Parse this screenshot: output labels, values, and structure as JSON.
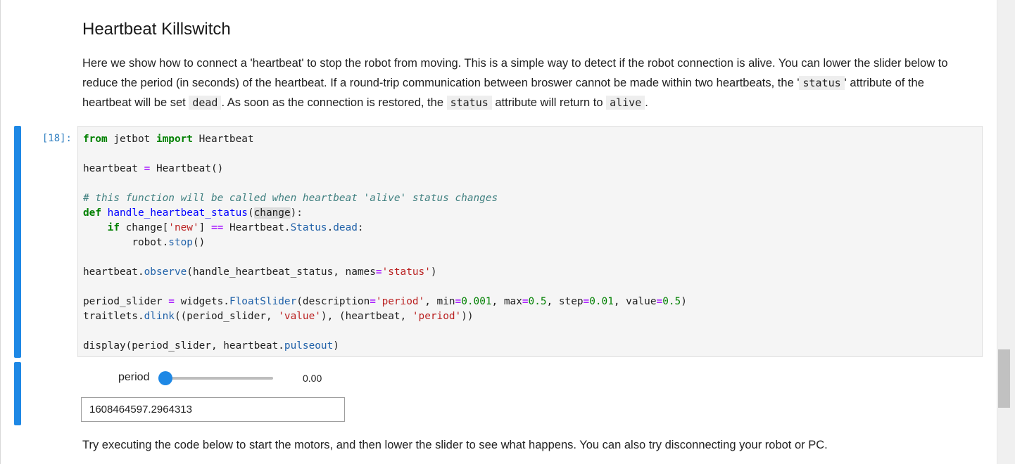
{
  "heading": "Heartbeat Killswitch",
  "intro": {
    "part1": "Here we show how to connect a 'heartbeat' to stop the robot from moving. This is a simple way to detect if the robot connection is alive. You can lower the slider below to reduce the period (in seconds) of the heartbeat. If a round-trip communication between broswer cannot be made within two heartbeats, the '",
    "code1": "status",
    "part2": "' attribute of the heartbeat will be set ",
    "code2": "dead",
    "part3": ". As soon as the connection is restored, the ",
    "code3": "status",
    "part4": " attribute will return to ",
    "code4": "alive",
    "part5": "."
  },
  "cell": {
    "prompt": "[18]:",
    "code": {
      "l1_from": "from",
      "l1_mod": " jetbot ",
      "l1_import": "import",
      "l1_name": " Heartbeat",
      "l3_var": "heartbeat ",
      "l3_eq": "=",
      "l3_rest": " Heartbeat()",
      "l5_comment": "# this function will be called when heartbeat 'alive' status changes",
      "l6_def": "def",
      "l6_fn": "handle_heartbeat_status",
      "l6_open": "(",
      "l6_arg": "change",
      "l6_close": "):",
      "l7_if": "if",
      "l7_a": " change[",
      "l7_str": "'new'",
      "l7_b": "] ",
      "l7_op": "==",
      "l7_c": " Heartbeat.",
      "l7_status": "Status",
      "l7_d": ".",
      "l7_dead": "dead",
      "l7_e": ":",
      "l8_a": "robot.",
      "l8_stop": "stop",
      "l8_b": "()",
      "l10_a": "heartbeat.",
      "l10_observe": "observe",
      "l10_b": "(handle_heartbeat_status, names",
      "l10_eq": "=",
      "l10_str": "'status'",
      "l10_c": ")",
      "l12_a": "period_slider ",
      "l12_eq": "=",
      "l12_b": " widgets.",
      "l12_cls": "FloatSlider",
      "l12_c": "(description",
      "l12_eq2": "=",
      "l12_s1": "'period'",
      "l12_d": ", min",
      "l12_eq3": "=",
      "l12_n1": "0.001",
      "l12_e": ", max",
      "l12_eq4": "=",
      "l12_n2": "0.5",
      "l12_f": ", step",
      "l12_eq5": "=",
      "l12_n3": "0.01",
      "l12_g": ", value",
      "l12_eq6": "=",
      "l12_n4": "0.5",
      "l12_h": ")",
      "l13_a": "traitlets.",
      "l13_dlink": "dlink",
      "l13_b": "((period_slider, ",
      "l13_s1": "'value'",
      "l13_c": "), (heartbeat, ",
      "l13_s2": "'period'",
      "l13_d": "))",
      "l15_a": "display(period_slider, heartbeat.",
      "l15_pulse": "pulseout",
      "l15_b": ")"
    }
  },
  "widget": {
    "slider_label": "period",
    "slider_value_text": "0.00",
    "slider_fraction": 0.0,
    "pulse_output": "1608464597.2964313"
  },
  "outro": "Try executing the code below to start the motors, and then lower the slider to see what happens. You can also try disconnecting your robot or PC.",
  "colors": {
    "accent": "#1e88e5",
    "prompt": "#307fc1"
  }
}
